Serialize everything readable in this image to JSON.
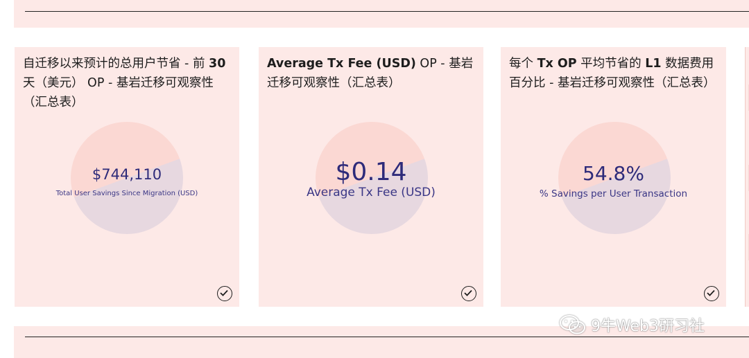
{
  "cards": [
    {
      "title_parts": [
        "自迁移以来预计的总用户节省 - 前 ",
        "30",
        " 天（美元） OP - 基岩迁移可观察性（汇总表）"
      ],
      "value": "$744,110",
      "label": "Total User Savings Since Migration (USD)"
    },
    {
      "title_parts": [
        "Average Tx Fee (USD)",
        " OP - 基岩迁移可观察性（汇总表）"
      ],
      "value": "$0.14",
      "label": "Average Tx Fee (USD)"
    },
    {
      "title_parts": [
        "每个 ",
        "Tx OP",
        " 平均节省的 ",
        "L1",
        " 数据费用百分比 - 基岩迁移可观察性（汇总表）"
      ],
      "value": "54.8%",
      "label": "% Savings per User Transaction"
    }
  ],
  "icons": {
    "card_action": "check-circle-icon",
    "watermark": "wechat-icon"
  },
  "watermark": {
    "text": "9牛Web3研习社"
  },
  "colors": {
    "card_bg": "#fde9e7",
    "gauge_top": "#fbd8d3",
    "gauge_bottom": "#e7d8e0",
    "metric_text": "#2e2b7a"
  }
}
